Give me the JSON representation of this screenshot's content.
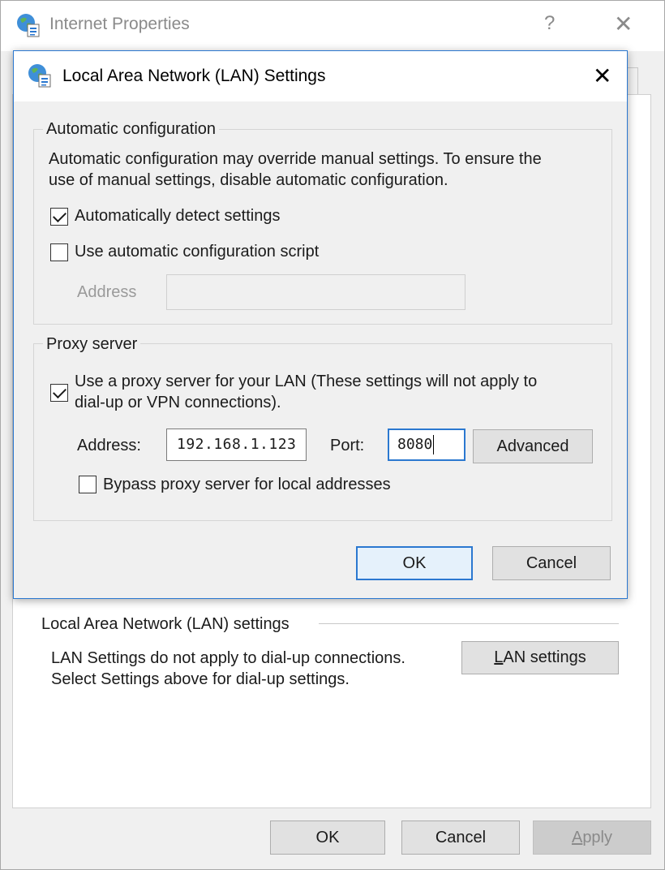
{
  "parent": {
    "title": "Internet Properties",
    "help_glyph": "?",
    "close_glyph": "✕",
    "lan_group_title": "Local Area Network (LAN) settings",
    "lan_desc_line1": "LAN Settings do not apply to dial-up connections.",
    "lan_desc_line2": "Select Settings above for dial-up settings.",
    "lan_settings_button": {
      "accel": "L",
      "rest": "AN settings"
    },
    "ok_label": "OK",
    "cancel_label": "Cancel",
    "apply_label": {
      "accel": "A",
      "rest": "pply"
    }
  },
  "dialog": {
    "title": "Local Area Network (LAN) Settings",
    "close_glyph": "✕",
    "auto_config": {
      "group_title": "Automatic configuration",
      "description_line1": "Automatic configuration may override manual settings.  To ensure the",
      "description_line2": "use of manual settings, disable automatic configuration.",
      "detect_label": "Automatically detect settings",
      "detect_checked": true,
      "script_label": "Use automatic configuration script",
      "script_checked": false,
      "address_label": "Address",
      "address_value": ""
    },
    "proxy": {
      "group_title": "Proxy server",
      "use_proxy_line1": "Use a proxy server for your LAN (These settings will not apply to",
      "use_proxy_line2": "dial-up or VPN connections).",
      "use_proxy_checked": true,
      "address_label": "Address:",
      "address_value": "192.168.1.123",
      "port_label": "Port:",
      "port_value": "8080",
      "advanced_label": "Advanced",
      "bypass_label": "Bypass proxy server for local addresses",
      "bypass_checked": false
    },
    "ok_label": "OK",
    "cancel_label": "Cancel"
  },
  "colors": {
    "accent": "#2b78d0",
    "window_bg": "#f0f0f0",
    "button_bg": "#e1e1e1"
  },
  "icons": [
    "globe-settings-icon",
    "close-icon",
    "help-icon",
    "checkbox-checked",
    "checkbox-unchecked"
  ]
}
